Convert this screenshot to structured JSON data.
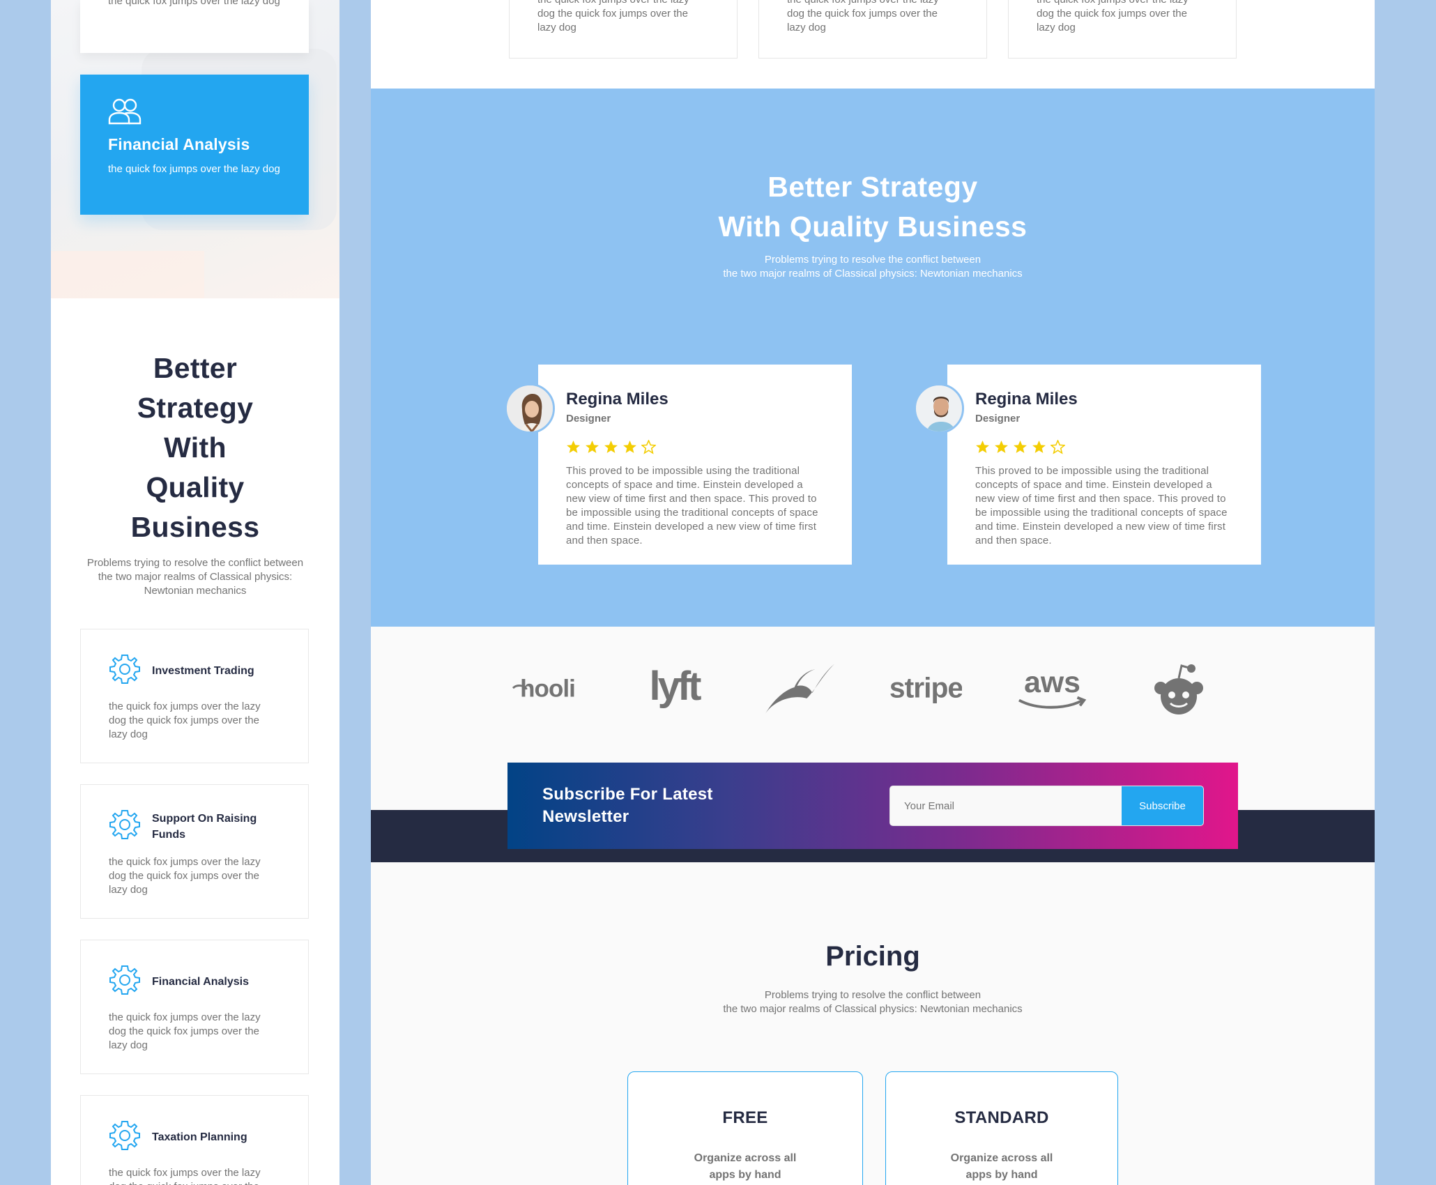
{
  "mobile": {
    "top_card_text": "the quick fox jumps over the lazy dog",
    "blue_card": {
      "icon": "users-icon",
      "title": "Financial Analysis",
      "text": "the quick fox jumps over the lazy dog"
    },
    "title_lines": [
      "Better",
      "Strategy",
      "With",
      "Quality",
      "Business"
    ],
    "subtitle": "Problems trying to resolve the conflict between the two major realms of Classical physics: Newtonian mechanics",
    "features": [
      {
        "icon": "gear-icon",
        "title": "Investment Trading",
        "text": "the quick fox jumps over the lazy dog the quick fox jumps over the lazy dog"
      },
      {
        "icon": "gear-icon",
        "title": "Support On Raising Funds",
        "text": "the quick fox jumps over the lazy dog the quick fox jumps over the lazy dog"
      },
      {
        "icon": "gear-icon",
        "title": "Financial Analysis",
        "text": "the quick fox jumps over the lazy dog the quick fox jumps over the lazy dog"
      },
      {
        "icon": "gear-icon",
        "title": "Taxation Planning",
        "text": "the quick fox jumps over the lazy dog the quick fox jumps over the lazy"
      }
    ]
  },
  "services": {
    "cards": [
      {
        "text": "the quick fox jumps over the lazy dog the quick fox jumps over the lazy dog"
      },
      {
        "text": "the quick fox jumps over the lazy dog the quick fox jumps over the lazy dog"
      },
      {
        "text": "the quick fox jumps over the lazy dog the quick fox jumps over the lazy dog"
      }
    ]
  },
  "testimonials": {
    "title_line1": "Better Strategy",
    "title_line2": "With Quality Business",
    "subtitle_line1": "Problems trying to resolve the conflict between",
    "subtitle_line2": "the two major realms of Classical physics: Newtonian mechanics",
    "items": [
      {
        "name": "Regina Miles",
        "role": "Designer",
        "rating": 4,
        "max_rating": 5,
        "text": "This proved to be impossible using the traditional concepts of space and time. Einstein developed a new view of time first and then space. This proved to be impossible using the traditional concepts of space and time. Einstein developed a new view of time first and then space."
      },
      {
        "name": "Regina Miles",
        "role": "Designer",
        "rating": 4,
        "max_rating": 5,
        "text": "This proved to be impossible using the traditional concepts of space and time. Einstein developed a new view of time first and then space. This proved to be impossible using the traditional concepts of space and time. Einstein developed a new view of time first and then space."
      }
    ],
    "star_color": "#f3cd03"
  },
  "clients": {
    "logos": [
      "hooli",
      "lyft",
      "leaf-logo",
      "stripe",
      "aws",
      "reddit-logo"
    ]
  },
  "newsletter": {
    "title": "Subscribe For Latest Newsletter",
    "email_placeholder": "Your Email",
    "button_label": "Subscribe"
  },
  "pricing": {
    "title": "Pricing",
    "subtitle_line1": "Problems trying to resolve the conflict between",
    "subtitle_line2": "the two major realms of Classical physics: Newtonian mechanics",
    "plans": [
      {
        "name": "FREE",
        "desc": "Organize across all apps by hand"
      },
      {
        "name": "STANDARD",
        "desc": "Organize across all apps by hand"
      }
    ]
  },
  "colors": {
    "primary": "#23a6f0",
    "dark": "#252b42",
    "muted": "#737373",
    "testimonial_bg": "#8ec2f2",
    "page_bg": "#abcaeb"
  }
}
